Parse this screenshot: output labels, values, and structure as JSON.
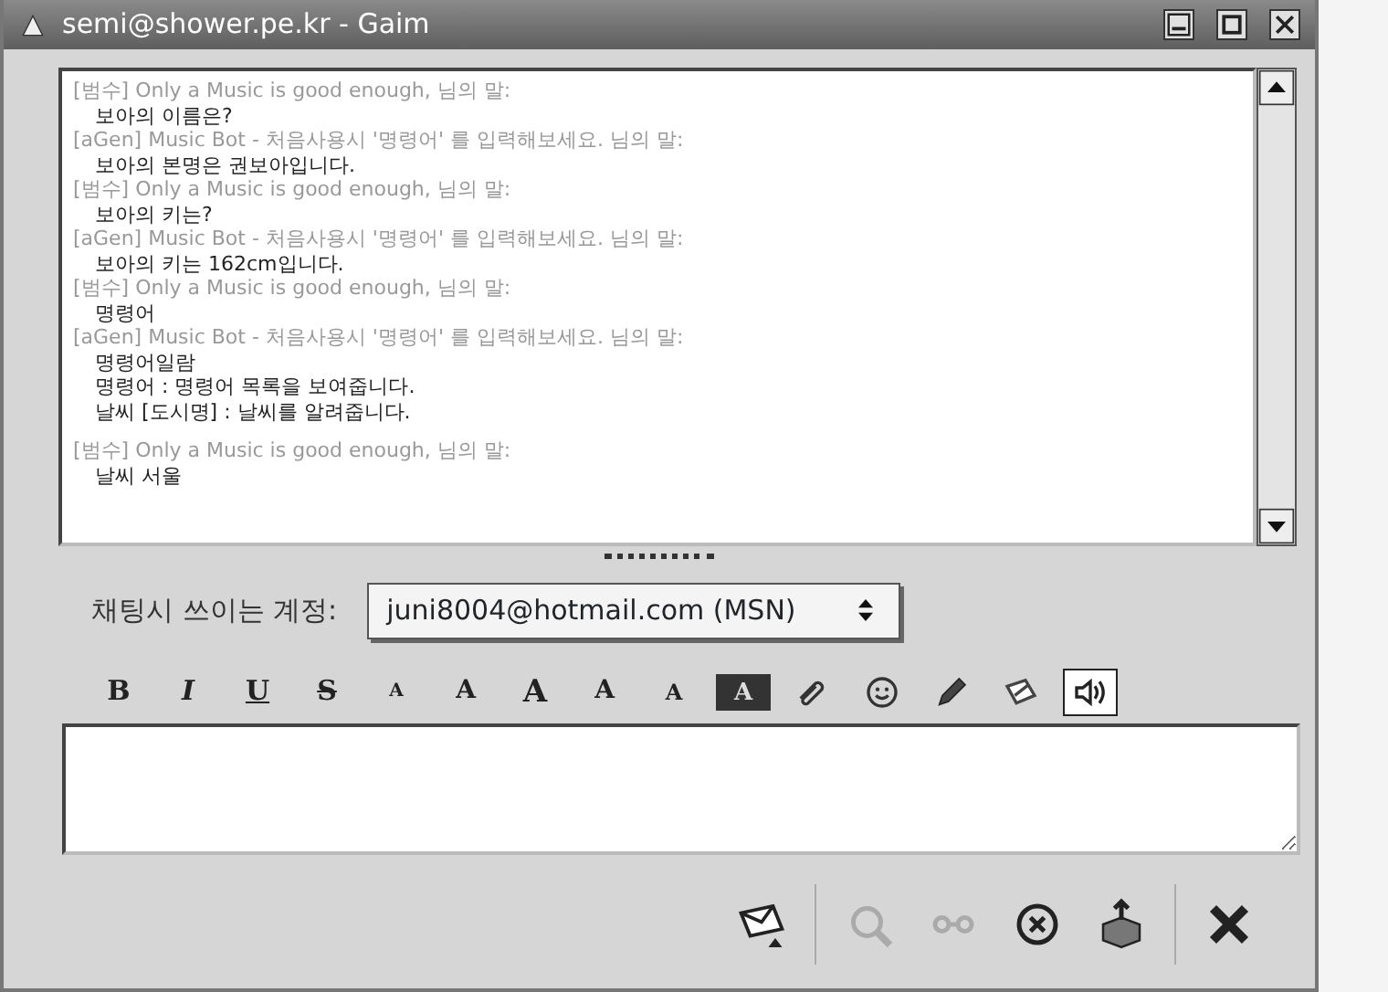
{
  "window": {
    "title": "semi@shower.pe.kr - Gaim"
  },
  "messages": [
    {
      "header": "[범수] Only a Music is good enough, 님의 말:",
      "lines": [
        "보아의 이름은?"
      ]
    },
    {
      "header": "[aGen] Music Bot - 처음사용시 '명령어' 를 입력해보세요. 님의 말:",
      "lines": [
        "보아의 본명은 권보아입니다."
      ]
    },
    {
      "header": "[범수] Only a Music is good enough, 님의 말:",
      "lines": [
        "보아의 키는?"
      ]
    },
    {
      "header": "[aGen] Music Bot - 처음사용시 '명령어' 를 입력해보세요. 님의 말:",
      "lines": [
        "보아의 키는 162cm입니다."
      ]
    },
    {
      "header": "[범수] Only a Music is good enough, 님의 말:",
      "lines": [
        "명령어"
      ]
    },
    {
      "header": "[aGen] Music Bot - 처음사용시 '명령어' 를 입력해보세요. 님의 말:",
      "lines": [
        "명령어일람",
        "명령어 : 명령어 목록을 보여줍니다.",
        "날씨 [도시명] : 날씨를 알려줍니다."
      ]
    },
    {
      "header": "[범수] Only a Music is good enough, 님의 말:",
      "lines": [
        "날씨 서울"
      ]
    }
  ],
  "account": {
    "label": "채팅시 쓰이는 계정:",
    "value": "juni8004@hotmail.com (MSN)"
  },
  "toolbar": [
    {
      "kind": "glyph",
      "text": "B",
      "pressed": false
    },
    {
      "kind": "glyph",
      "text": "I",
      "pressed": false
    },
    {
      "kind": "glyph",
      "text": "U",
      "pressed": false
    },
    {
      "kind": "glyph",
      "text": "S",
      "pressed": false
    },
    {
      "kind": "glyph",
      "text": "A",
      "pressed": false
    },
    {
      "kind": "glyph",
      "text": "A",
      "pressed": false
    },
    {
      "kind": "glyph",
      "text": "A",
      "pressed": false
    },
    {
      "kind": "glyph",
      "text": "A",
      "pressed": false
    },
    {
      "kind": "glyph",
      "text": "A",
      "pressed": false
    },
    {
      "kind": "glyph",
      "text": "A",
      "pressed": false
    },
    {
      "kind": "icon",
      "pressed": false
    },
    {
      "kind": "icon",
      "pressed": false
    },
    {
      "kind": "icon",
      "pressed": false
    },
    {
      "kind": "icon",
      "pressed": false
    },
    {
      "kind": "icon",
      "pressed": true
    }
  ],
  "actions": [
    {
      "disabled": false
    },
    {
      "disabled": true
    },
    {
      "disabled": true
    },
    {
      "disabled": false
    },
    {
      "disabled": false
    },
    {
      "disabled": false
    }
  ]
}
